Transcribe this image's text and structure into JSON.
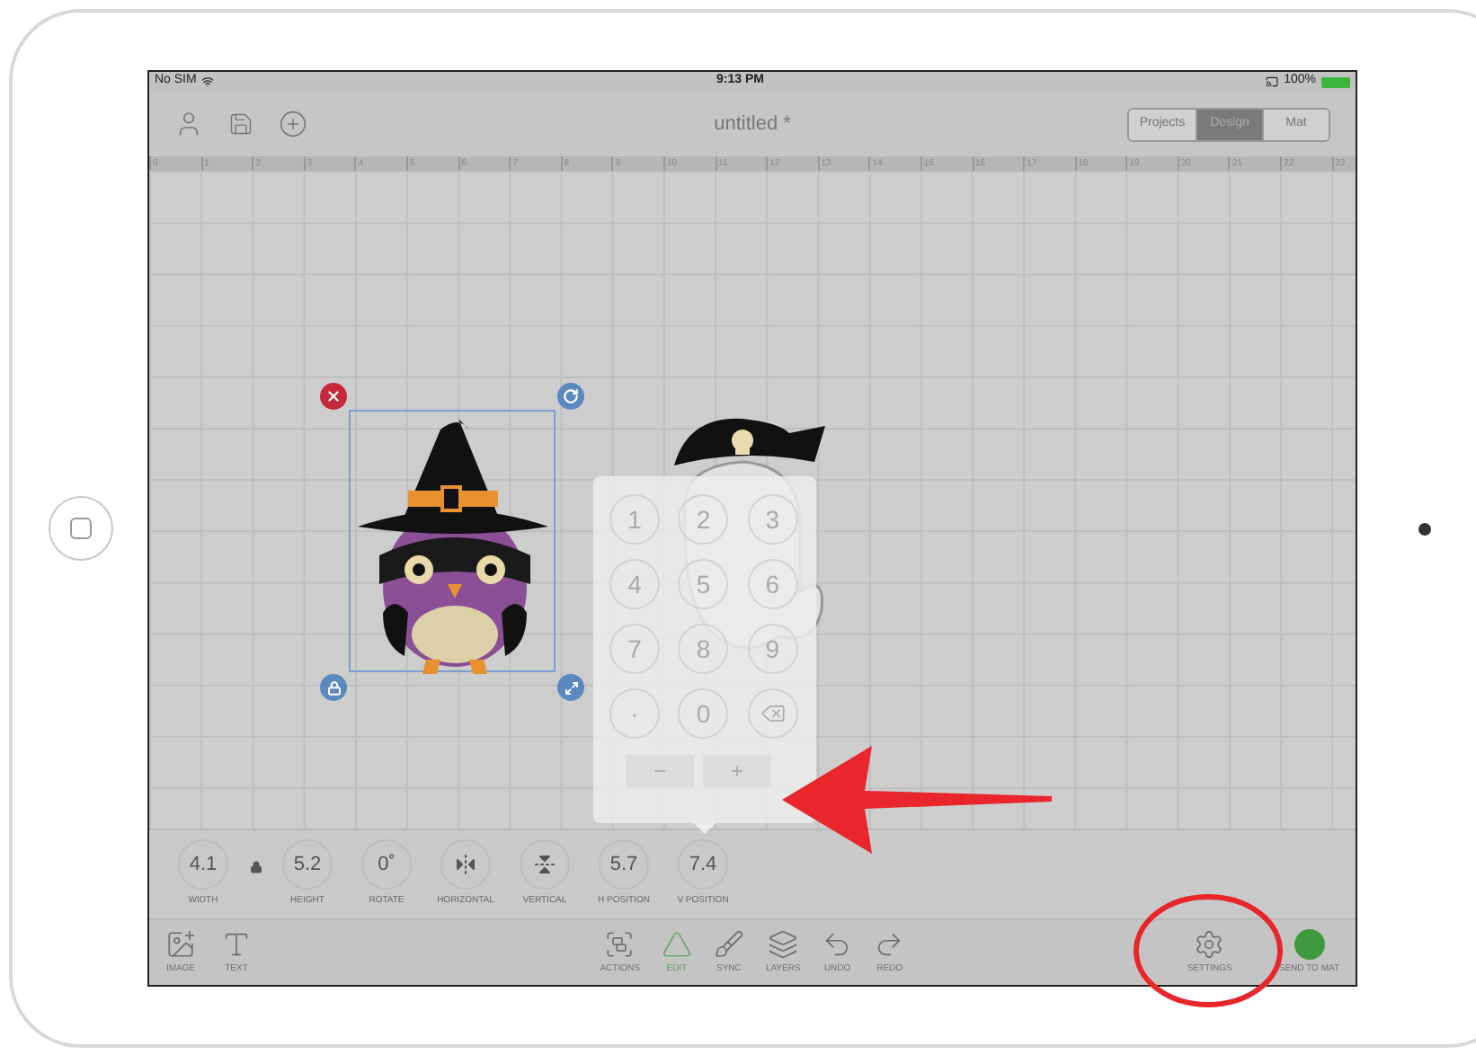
{
  "status_bar": {
    "carrier": "No SIM",
    "time": "9:13 PM",
    "battery": "100%"
  },
  "toolbar": {
    "title": "untitled *",
    "segments": [
      {
        "label": "Projects",
        "selected": false
      },
      {
        "label": "Design",
        "selected": true
      },
      {
        "label": "Mat",
        "selected": false
      }
    ]
  },
  "ruler": {
    "labels": [
      "0",
      "1",
      "2",
      "3",
      "4",
      "5",
      "6",
      "7",
      "8",
      "9",
      "10",
      "11",
      "12",
      "13",
      "14",
      "15",
      "16",
      "17",
      "18",
      "19",
      "20",
      "21",
      "22",
      "23"
    ]
  },
  "canvas": {
    "images": [
      {
        "kind": "owl",
        "selected": true
      },
      {
        "kind": "ghost",
        "selected": false
      }
    ]
  },
  "keypad": {
    "keys": [
      {
        "kind": "digit",
        "label": "1"
      },
      {
        "kind": "digit",
        "label": "2"
      },
      {
        "kind": "digit",
        "label": "3"
      },
      {
        "kind": "digit",
        "label": "4"
      },
      {
        "kind": "digit",
        "label": "5"
      },
      {
        "kind": "digit",
        "label": "6"
      },
      {
        "kind": "digit",
        "label": "7"
      },
      {
        "kind": "digit",
        "label": "8"
      },
      {
        "kind": "digit",
        "label": "9"
      },
      {
        "kind": "digit",
        "label": "·"
      },
      {
        "kind": "digit",
        "label": "0"
      },
      {
        "kind": "backspace"
      }
    ],
    "sign_buttons": [
      "−",
      "+"
    ]
  },
  "properties": {
    "aspect_locked": true,
    "items": [
      {
        "kind": "value",
        "value": "4.1",
        "label": "WIDTH"
      },
      {
        "kind": "value",
        "value": "5.2",
        "label": "HEIGHT"
      },
      {
        "kind": "value",
        "value": "0˚",
        "label": "ROTATE"
      },
      {
        "kind": "flip-horizontal",
        "label": "HORIZONTAL"
      },
      {
        "kind": "flip-vertical",
        "label": "VERTICAL"
      },
      {
        "kind": "value",
        "value": "5.7",
        "label": "H POSITION"
      },
      {
        "kind": "value",
        "value": "7.4",
        "label": "V POSITION"
      }
    ]
  },
  "bottom_bar": {
    "left": [
      {
        "kind": "image",
        "label": "IMAGE"
      },
      {
        "kind": "text",
        "label": "TEXT"
      }
    ],
    "center": [
      {
        "kind": "actions",
        "label": "ACTIONS",
        "selected": false
      },
      {
        "kind": "edit",
        "label": "EDIT",
        "selected": true
      },
      {
        "kind": "sync",
        "label": "SYNC",
        "selected": false
      },
      {
        "kind": "layers",
        "label": "LAYERS",
        "selected": false
      },
      {
        "kind": "undo",
        "label": "UNDO",
        "selected": false
      },
      {
        "kind": "redo",
        "label": "REDO",
        "selected": false
      }
    ],
    "right": [
      {
        "kind": "settings",
        "label": "SETTINGS"
      },
      {
        "kind": "send",
        "label": "SEND TO MAT"
      }
    ]
  },
  "annotations": [
    {
      "kind": "arrow"
    },
    {
      "kind": "ellipse"
    }
  ]
}
